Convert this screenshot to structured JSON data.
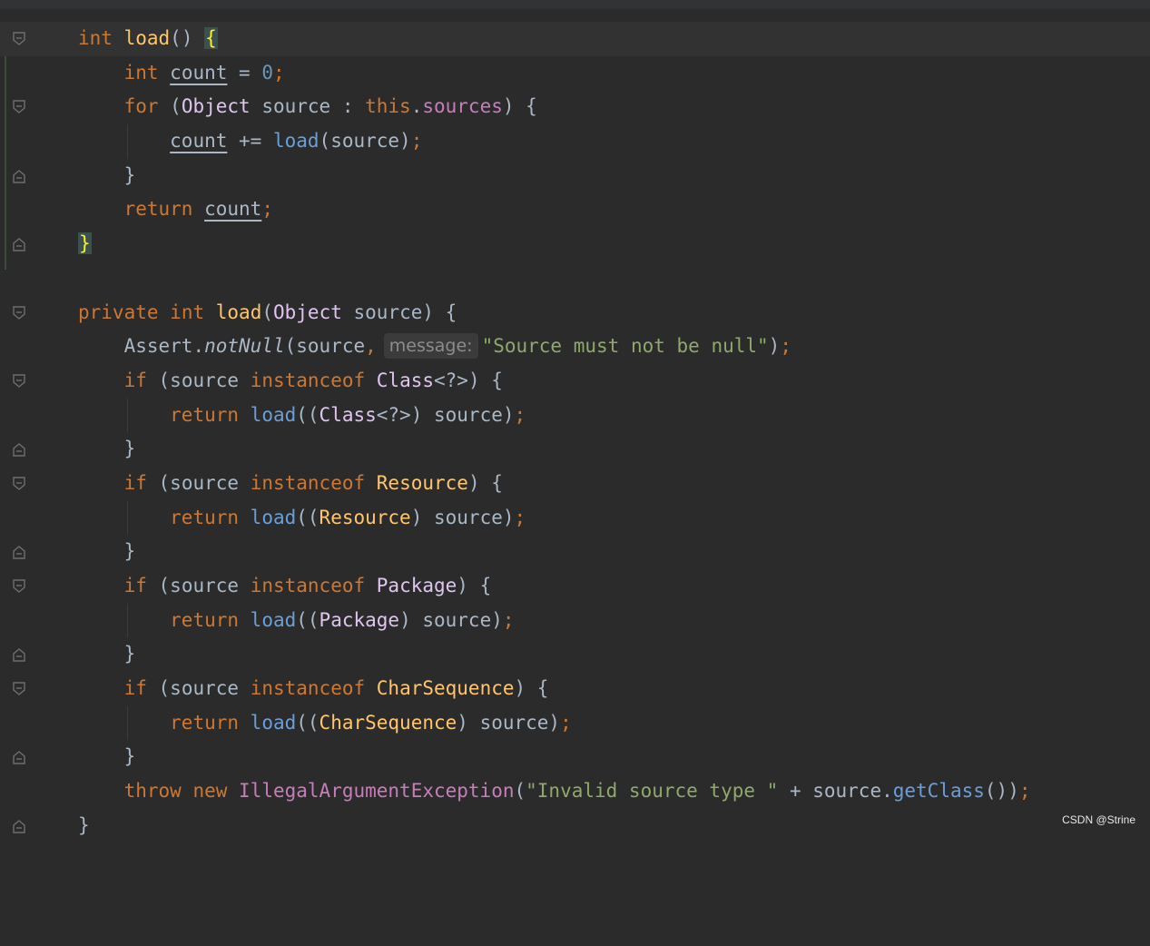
{
  "editor": {
    "language": "java",
    "colors": {
      "background": "#2b2b2b",
      "keyword": "#cc7832",
      "number": "#6897bb",
      "method_decl": "#ffc66d",
      "method_call": "#6a9fd8",
      "string": "#8fa96b",
      "type": "#e0c4f0",
      "exception": "#c77dbb"
    },
    "param_hint": "message:",
    "lines": [
      "int load() {",
      "    int count = 0;",
      "    for (Object source : this.sources) {",
      "        count += load(source);",
      "    }",
      "    return count;",
      "}",
      "",
      "private int load(Object source) {",
      "    Assert.notNull(source, \"Source must not be null\");",
      "    if (source instanceof Class<?>) {",
      "        return load((Class<?>) source);",
      "    }",
      "    if (source instanceof Resource) {",
      "        return load((Resource) source);",
      "    }",
      "    if (source instanceof Package) {",
      "        return load((Package) source);",
      "    }",
      "    if (source instanceof CharSequence) {",
      "        return load((CharSequence) source);",
      "    }",
      "    throw new IllegalArgumentException(\"Invalid source type \" + source.getClass());",
      "}"
    ]
  },
  "tokens": {
    "int": "int",
    "load": "load",
    "count": "count",
    "zero": "0",
    "for": "for",
    "Object": "Object",
    "source": "source",
    "this": "this",
    "sources": "sources",
    "return": "return",
    "private": "private",
    "Assert": "Assert",
    "notNull": "notNull",
    "msg_str": "\"Source must not be null\"",
    "if": "if",
    "instanceof": "instanceof",
    "Class": "Class",
    "generic": "<?>",
    "Resource": "Resource",
    "Package": "Package",
    "CharSequence": "CharSequence",
    "throw": "throw",
    "new": "new",
    "IllegalArgumentException": "IllegalArgumentException",
    "invalid_str": "\"Invalid source type \"",
    "getClass": "getClass"
  },
  "watermark": "CSDN @Strine"
}
